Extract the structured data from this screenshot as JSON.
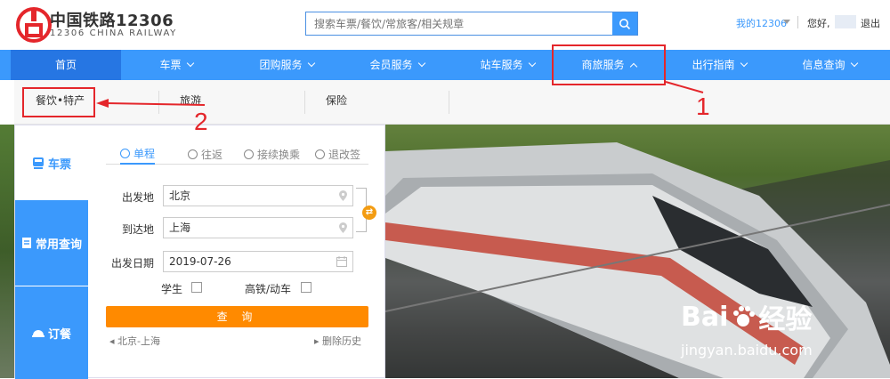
{
  "header": {
    "logo_cn": "中国铁路12306",
    "logo_en": "12306 CHINA RAILWAY",
    "search_placeholder": "搜索车票/餐饮/常旅客/相关规章",
    "my_account": "我的12306",
    "hello": "您好,",
    "logout": "退出"
  },
  "nav": {
    "items": [
      {
        "label": "首页"
      },
      {
        "label": "车票"
      },
      {
        "label": "团购服务"
      },
      {
        "label": "会员服务"
      },
      {
        "label": "站车服务"
      },
      {
        "label": "商旅服务"
      },
      {
        "label": "出行指南"
      },
      {
        "label": "信息查询"
      }
    ]
  },
  "submenu": {
    "items": [
      {
        "label": "餐饮•特产"
      },
      {
        "label": "旅游"
      },
      {
        "label": "保险"
      }
    ]
  },
  "side_tabs": [
    {
      "label": "车票",
      "icon": "train-icon"
    },
    {
      "label": "常用查询",
      "icon": "document-icon"
    },
    {
      "label": "订餐",
      "icon": "dish-icon"
    }
  ],
  "trip_tabs": [
    {
      "label": "单程"
    },
    {
      "label": "往返"
    },
    {
      "label": "接续换乘"
    },
    {
      "label": "退改签"
    }
  ],
  "form": {
    "from_label": "出发地",
    "from_value": "北京",
    "to_label": "到达地",
    "to_value": "上海",
    "date_label": "出发日期",
    "date_value": "2019-07-26",
    "student_label": "学生",
    "highspeed_label": "高铁/动车",
    "query_label": "查 询",
    "history_item": "北京-上海",
    "clear_history": "删除历史"
  },
  "annotations": {
    "one": "1",
    "two": "2"
  },
  "watermark": {
    "brand": "Bai",
    "brand_cn": "经验",
    "url": "jingyan.baidu.com"
  },
  "colors": {
    "primary": "#3b99fc",
    "active_nav": "#2676e3",
    "query_button": "#ff8a00",
    "annotation": "#e4262b"
  }
}
